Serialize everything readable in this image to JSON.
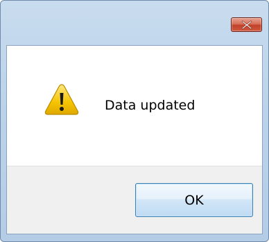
{
  "dialog": {
    "close_icon": "close-x-icon",
    "icon": "warning-triangle-icon",
    "message": "Data updated",
    "ok_label": "OK"
  },
  "colors": {
    "titlebar": "#bcd3ea",
    "close_button": "#c1412a",
    "content_background": "#ffffff",
    "button_area_background": "#f0f0f0",
    "ok_button_border": "#3c7fb1",
    "warning_yellow": "#f5c400"
  }
}
